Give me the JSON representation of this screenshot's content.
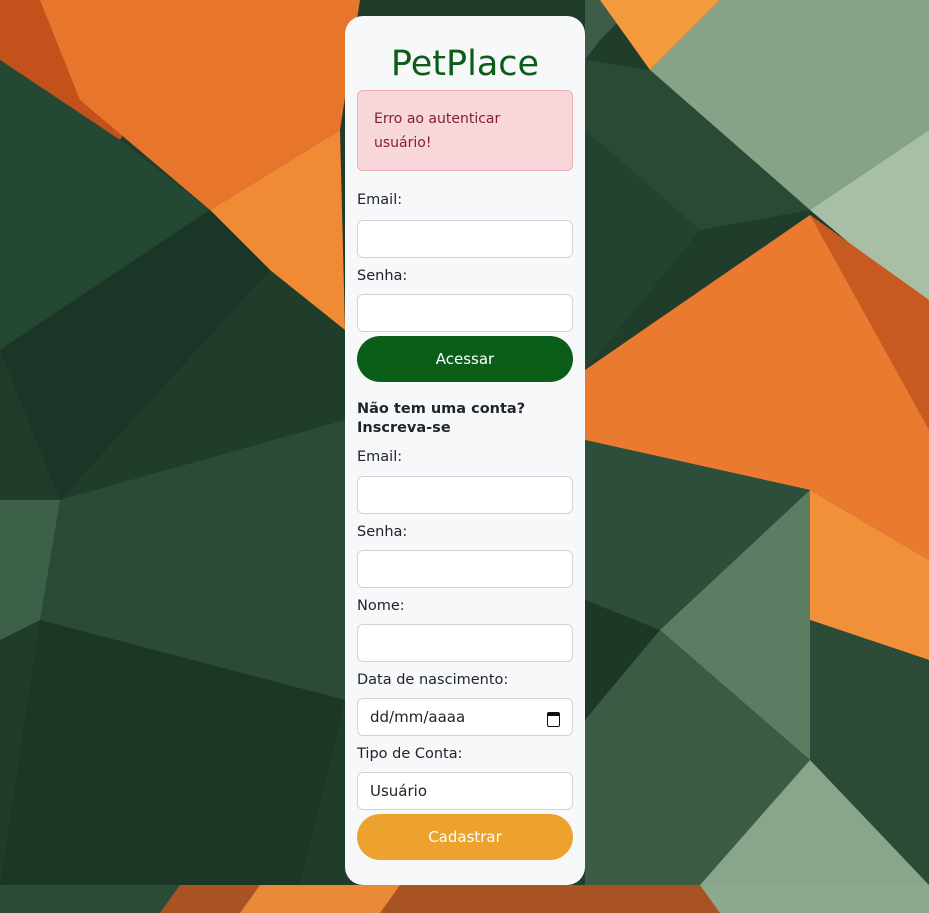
{
  "app": {
    "title": "PetPlace"
  },
  "alert": {
    "message": "Erro ao autenticar usuário!"
  },
  "login": {
    "email_label": "Email:",
    "email_value": "",
    "password_label": "Senha:",
    "password_value": "",
    "submit_label": "Acessar"
  },
  "signup": {
    "heading": "Não tem uma conta? Inscreva-se",
    "email_label": "Email:",
    "email_value": "",
    "password_label": "Senha:",
    "password_value": "",
    "name_label": "Nome:",
    "name_value": "",
    "birthdate_label": "Data de nascimento:",
    "birthdate_placeholder": "dd/mm/aaaa",
    "account_type_label": "Tipo de Conta:",
    "account_type_value": "Usuário",
    "submit_label": "Cadastrar"
  },
  "colors": {
    "brand_green": "#0b5e18",
    "accent_orange": "#eca22c",
    "alert_bg": "#f8d7da",
    "alert_text": "#842029"
  },
  "icons": {
    "date_picker": "calendar-icon"
  }
}
